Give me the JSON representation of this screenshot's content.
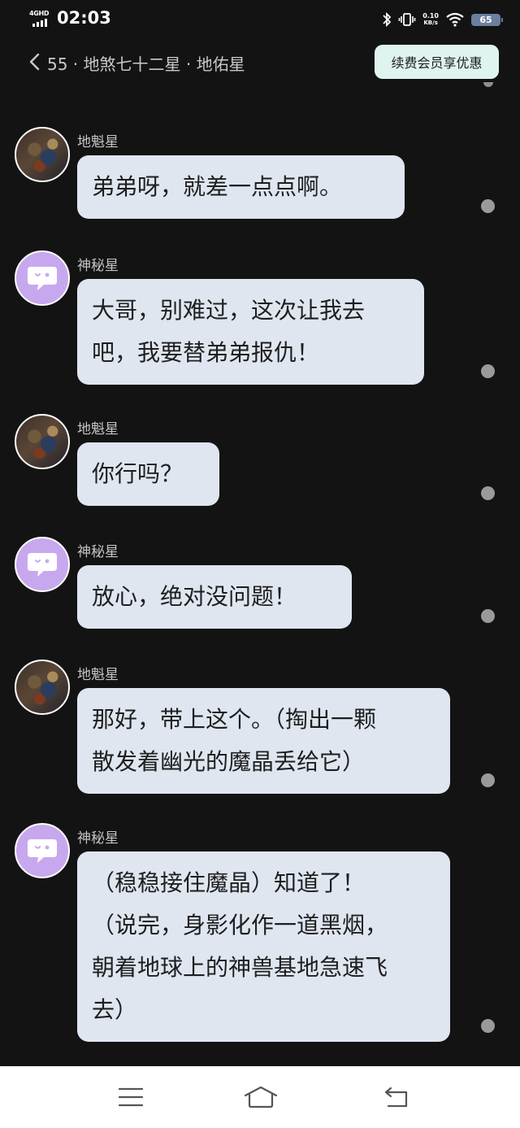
{
  "status_bar": {
    "network": "4GHD",
    "time": "02:03",
    "speed_value": "0.10",
    "speed_unit": "KB/s",
    "battery": "65"
  },
  "header": {
    "title": "55 · 地煞七十二星 · 地佑星",
    "vip_label": "续费会员享优惠"
  },
  "messages": [
    {
      "sender": "地魁星",
      "avatar": "warrior-avatar",
      "lines": [
        "弟弟呀，就差一点点啊。"
      ]
    },
    {
      "sender": "神秘星",
      "avatar": "chat-bubble-avatar",
      "lines": [
        "大哥，别难过，这次让我去",
        "吧，我要替弟弟报仇！"
      ]
    },
    {
      "sender": "地魁星",
      "avatar": "warrior-avatar",
      "lines": [
        "你行吗？"
      ]
    },
    {
      "sender": "神秘星",
      "avatar": "chat-bubble-avatar",
      "lines": [
        "放心，绝对没问题！"
      ]
    },
    {
      "sender": "地魁星",
      "avatar": "warrior-avatar",
      "lines": [
        "那好，带上这个。（掏出一颗",
        "散发着幽光的魔晶丢给它）"
      ]
    },
    {
      "sender": "神秘星",
      "avatar": "chat-bubble-avatar",
      "lines": [
        "（稳稳接住魔晶）知道了！",
        "（说完，身影化作一道黑烟，",
        "朝着地球上的神兽基地急速飞",
        "去）"
      ]
    }
  ],
  "nav": {
    "menu_icon": "menu-icon",
    "home_icon": "home-icon",
    "back_icon": "back-icon"
  }
}
